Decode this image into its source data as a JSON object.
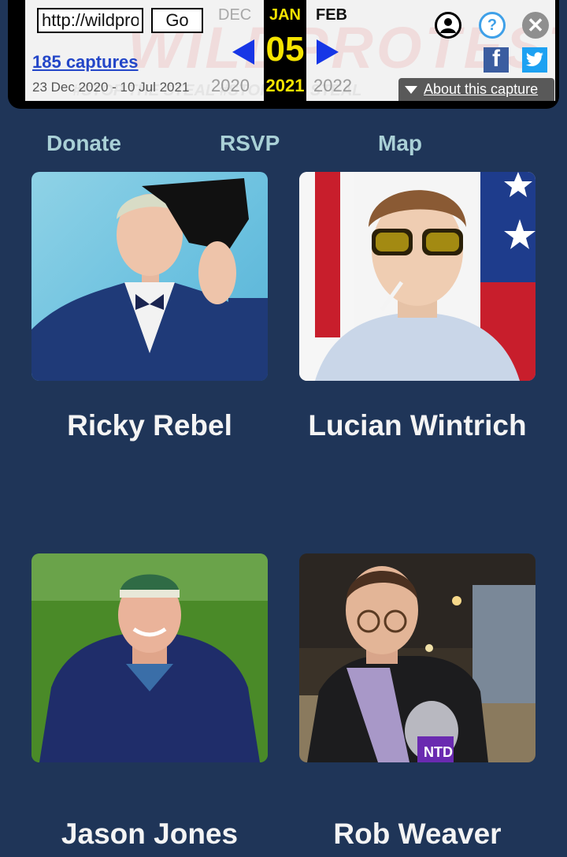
{
  "wayback": {
    "url_value": "http://wildprotest.com",
    "go_label": "Go",
    "captures_label": "185 captures",
    "capture_range": "23 Dec 2020 - 10 Jul 2021",
    "prev_month": "DEC",
    "current_month": "JAN",
    "next_month": "FEB",
    "current_day": "05",
    "prev_year": "2020",
    "current_year": "2021",
    "next_year": "2022",
    "about_label": "About this capture",
    "help_glyph": "?",
    "close_glyph": "✕",
    "facebook_glyph": "f",
    "watermark": "WILDPROTEST.COM",
    "icons": [
      "user-icon",
      "help-icon",
      "close-icon",
      "facebook-icon",
      "twitter-icon",
      "arrow-left-icon",
      "arrow-right-icon"
    ],
    "accent_color": "#1736e6",
    "highlight_color": "#f5e400"
  },
  "nav": {
    "items": [
      "Donate",
      "RSVP",
      "Map"
    ],
    "color": "#a9d0d6"
  },
  "speakers": [
    {
      "name": "Ricky Rebel"
    },
    {
      "name": "Lucian Wintrich"
    },
    {
      "name": "Jason Jones"
    },
    {
      "name": "Rob Weaver"
    }
  ],
  "page_background": "#1f3558"
}
